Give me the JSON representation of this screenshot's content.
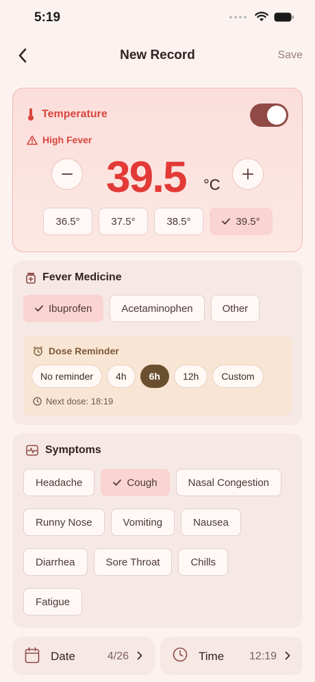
{
  "status": {
    "time": "5:19"
  },
  "nav": {
    "title": "New Record",
    "save_label": "Save"
  },
  "temperature": {
    "label": "Temperature",
    "enabled": true,
    "alert": "High Fever",
    "value": "39.5",
    "unit": "°C",
    "presets": [
      "36.5°",
      "37.5°",
      "38.5°",
      "39.5°"
    ],
    "selected_preset": "39.5°"
  },
  "medicine": {
    "title": "Fever Medicine",
    "options": [
      "Ibuprofen",
      "Acetaminophen",
      "Other"
    ],
    "selected": "Ibuprofen",
    "reminder": {
      "title": "Dose Reminder",
      "options": [
        "No reminder",
        "4h",
        "6h",
        "12h",
        "Custom"
      ],
      "selected": "6h",
      "next_dose": "Next dose: 18:19"
    }
  },
  "symptoms": {
    "title": "Symptoms",
    "rows": [
      [
        "Headache",
        "Cough",
        "Nasal Congestion"
      ],
      [
        "Runny Nose",
        "Vomiting",
        "Nausea"
      ],
      [
        "Diarrhea",
        "Sore Throat",
        "Chills"
      ],
      [
        "Fatigue"
      ]
    ],
    "selected": [
      "Cough"
    ]
  },
  "date": {
    "label": "Date",
    "value": "4/26"
  },
  "time": {
    "label": "Time",
    "value": "12:19"
  },
  "colors": {
    "accent_red": "#e23a36",
    "toggle": "#8f4a45",
    "reminder_selected": "#6b5030",
    "chip_selected": "#fad4d1"
  }
}
